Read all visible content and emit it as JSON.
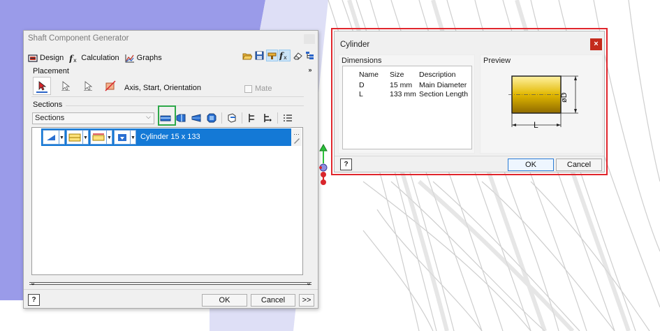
{
  "main_dialog": {
    "title": "Shaft Component Generator",
    "tabs": [
      {
        "label": "Design",
        "icon": "design-icon"
      },
      {
        "label": "Calculation",
        "icon": "calculation-icon"
      },
      {
        "label": "Graphs",
        "icon": "graphs-icon"
      }
    ],
    "toolbar_icons": [
      "open-folder-icon",
      "save-icon",
      "design-settings-icon",
      "calculation-settings-icon",
      "eraser-icon",
      "tree-icon"
    ],
    "placement": {
      "label": "Placement",
      "text": "Axis, Start, Orientation",
      "mate_label": "Mate"
    },
    "sections": {
      "label": "Sections",
      "combo_value": "Sections",
      "row_text": "Cylinder 15 x 133"
    },
    "buttons": {
      "ok": "OK",
      "cancel": "Cancel",
      "more": ">>",
      "help": "?"
    }
  },
  "cylinder_dialog": {
    "title": "Cylinder",
    "close": "×",
    "dimensions_label": "Dimensions",
    "preview_label": "Preview",
    "columns": [
      "Name",
      "Size",
      "Description"
    ],
    "rows": [
      {
        "name": "D",
        "size": "15 mm",
        "description": "Main Diameter"
      },
      {
        "name": "L",
        "size": "133 mm",
        "description": "Section Length"
      }
    ],
    "preview_labels": {
      "length": "L",
      "diameter": "øD"
    },
    "buttons": {
      "ok": "OK",
      "cancel": "Cancel",
      "help": "?"
    }
  },
  "colors": {
    "selection_blue": "#1479d6",
    "highlight_green": "#2ea84a",
    "highlight_red": "#e0252c",
    "cylinder_gold": "#e2b800"
  }
}
